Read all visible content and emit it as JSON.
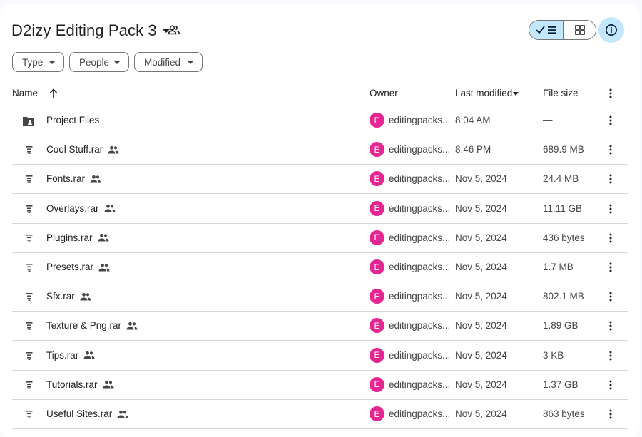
{
  "header": {
    "title": "D2izy Editing Pack 3"
  },
  "filters": [
    {
      "label": "Type"
    },
    {
      "label": "People"
    },
    {
      "label": "Modified"
    }
  ],
  "columns": {
    "name": "Name",
    "owner": "Owner",
    "last_modified": "Last modified",
    "file_size": "File size"
  },
  "files": [
    {
      "name": "Project Files",
      "icon": "shared-folder-icon",
      "shared": false,
      "owner_initial": "E",
      "owner": "editingpacks...",
      "modified": "8:04 AM",
      "size": "—"
    },
    {
      "name": "Cool Stuff.rar",
      "icon": "zip-file-icon",
      "shared": true,
      "owner_initial": "E",
      "owner": "editingpacks...",
      "modified": "8:46 PM",
      "size": "689.9 MB"
    },
    {
      "name": "Fonts.rar",
      "icon": "zip-file-icon",
      "shared": true,
      "owner_initial": "E",
      "owner": "editingpacks...",
      "modified": "Nov 5, 2024",
      "size": "24.4 MB"
    },
    {
      "name": "Overlays.rar",
      "icon": "zip-file-icon",
      "shared": true,
      "owner_initial": "E",
      "owner": "editingpacks...",
      "modified": "Nov 5, 2024",
      "size": "11.11 GB"
    },
    {
      "name": "Plugins.rar",
      "icon": "zip-file-icon",
      "shared": true,
      "owner_initial": "E",
      "owner": "editingpacks...",
      "modified": "Nov 5, 2024",
      "size": "436 bytes"
    },
    {
      "name": "Presets.rar",
      "icon": "zip-file-icon",
      "shared": true,
      "owner_initial": "E",
      "owner": "editingpacks...",
      "modified": "Nov 5, 2024",
      "size": "1.7 MB"
    },
    {
      "name": "Sfx.rar",
      "icon": "zip-file-icon",
      "shared": true,
      "owner_initial": "E",
      "owner": "editingpacks...",
      "modified": "Nov 5, 2024",
      "size": "802.1 MB"
    },
    {
      "name": "Texture & Png.rar",
      "icon": "zip-file-icon",
      "shared": true,
      "owner_initial": "E",
      "owner": "editingpacks...",
      "modified": "Nov 5, 2024",
      "size": "1.89 GB"
    },
    {
      "name": "Tips.rar",
      "icon": "zip-file-icon",
      "shared": true,
      "owner_initial": "E",
      "owner": "editingpacks...",
      "modified": "Nov 5, 2024",
      "size": "3 KB"
    },
    {
      "name": "Tutorials.rar",
      "icon": "zip-file-icon",
      "shared": true,
      "owner_initial": "E",
      "owner": "editingpacks...",
      "modified": "Nov 5, 2024",
      "size": "1.37 GB"
    },
    {
      "name": "Useful Sites.rar",
      "icon": "zip-file-icon",
      "shared": true,
      "owner_initial": "E",
      "owner": "editingpacks...",
      "modified": "Nov 5, 2024",
      "size": "863 bytes"
    }
  ],
  "colors": {
    "avatar": "#e52592",
    "toggle_active": "#c2e7ff",
    "info_button": "#c2e7ff"
  }
}
